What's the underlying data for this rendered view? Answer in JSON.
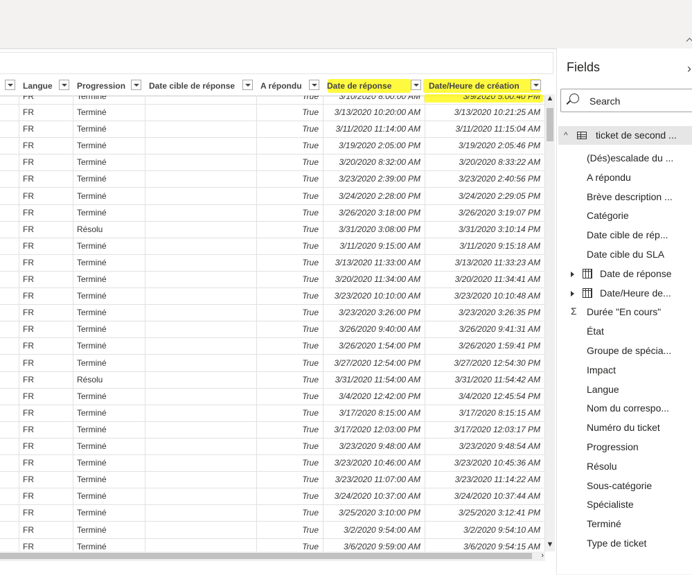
{
  "table": {
    "columns": [
      {
        "key": "blank",
        "label": ""
      },
      {
        "key": "langue",
        "label": "Langue"
      },
      {
        "key": "progression",
        "label": "Progression"
      },
      {
        "key": "date_cible",
        "label": "Date cible de réponse"
      },
      {
        "key": "a_repondu",
        "label": "A répondu"
      },
      {
        "key": "date_reponse",
        "label": "Date de réponse"
      },
      {
        "key": "date_creation",
        "label": "Date/Heure de création"
      }
    ],
    "partial_row": {
      "langue": "FR",
      "progression": "Terminé",
      "a_repondu": "True",
      "date_reponse": "3/10/2020 8:00:00 AM",
      "date_creation": "3/9/2020 5:00:40 PM"
    },
    "rows": [
      {
        "langue": "FR",
        "progression": "Terminé",
        "date_cible": "",
        "a_repondu": "True",
        "date_reponse": "3/13/2020 10:20:00 AM",
        "date_creation": "3/13/2020 10:21:25 AM"
      },
      {
        "langue": "FR",
        "progression": "Terminé",
        "date_cible": "",
        "a_repondu": "True",
        "date_reponse": "3/11/2020 11:14:00 AM",
        "date_creation": "3/11/2020 11:15:04 AM"
      },
      {
        "langue": "FR",
        "progression": "Terminé",
        "date_cible": "",
        "a_repondu": "True",
        "date_reponse": "3/19/2020 2:05:00 PM",
        "date_creation": "3/19/2020 2:05:46 PM"
      },
      {
        "langue": "FR",
        "progression": "Terminé",
        "date_cible": "",
        "a_repondu": "True",
        "date_reponse": "3/20/2020 8:32:00 AM",
        "date_creation": "3/20/2020 8:33:22 AM"
      },
      {
        "langue": "FR",
        "progression": "Terminé",
        "date_cible": "",
        "a_repondu": "True",
        "date_reponse": "3/23/2020 2:39:00 PM",
        "date_creation": "3/23/2020 2:40:56 PM"
      },
      {
        "langue": "FR",
        "progression": "Terminé",
        "date_cible": "",
        "a_repondu": "True",
        "date_reponse": "3/24/2020 2:28:00 PM",
        "date_creation": "3/24/2020 2:29:05 PM"
      },
      {
        "langue": "FR",
        "progression": "Terminé",
        "date_cible": "",
        "a_repondu": "True",
        "date_reponse": "3/26/2020 3:18:00 PM",
        "date_creation": "3/26/2020 3:19:07 PM"
      },
      {
        "langue": "FR",
        "progression": "Résolu",
        "date_cible": "",
        "a_repondu": "True",
        "date_reponse": "3/31/2020 3:08:00 PM",
        "date_creation": "3/31/2020 3:10:14 PM"
      },
      {
        "langue": "FR",
        "progression": "Terminé",
        "date_cible": "",
        "a_repondu": "True",
        "date_reponse": "3/11/2020 9:15:00 AM",
        "date_creation": "3/11/2020 9:15:18 AM"
      },
      {
        "langue": "FR",
        "progression": "Terminé",
        "date_cible": "",
        "a_repondu": "True",
        "date_reponse": "3/13/2020 11:33:00 AM",
        "date_creation": "3/13/2020 11:33:23 AM"
      },
      {
        "langue": "FR",
        "progression": "Terminé",
        "date_cible": "",
        "a_repondu": "True",
        "date_reponse": "3/20/2020 11:34:00 AM",
        "date_creation": "3/20/2020 11:34:41 AM"
      },
      {
        "langue": "FR",
        "progression": "Terminé",
        "date_cible": "",
        "a_repondu": "True",
        "date_reponse": "3/23/2020 10:10:00 AM",
        "date_creation": "3/23/2020 10:10:48 AM"
      },
      {
        "langue": "FR",
        "progression": "Terminé",
        "date_cible": "",
        "a_repondu": "True",
        "date_reponse": "3/23/2020 3:26:00 PM",
        "date_creation": "3/23/2020 3:26:35 PM"
      },
      {
        "langue": "FR",
        "progression": "Terminé",
        "date_cible": "",
        "a_repondu": "True",
        "date_reponse": "3/26/2020 9:40:00 AM",
        "date_creation": "3/26/2020 9:41:31 AM"
      },
      {
        "langue": "FR",
        "progression": "Terminé",
        "date_cible": "",
        "a_repondu": "True",
        "date_reponse": "3/26/2020 1:54:00 PM",
        "date_creation": "3/26/2020 1:59:41 PM"
      },
      {
        "langue": "FR",
        "progression": "Terminé",
        "date_cible": "",
        "a_repondu": "True",
        "date_reponse": "3/27/2020 12:54:00 PM",
        "date_creation": "3/27/2020 12:54:30 PM"
      },
      {
        "langue": "FR",
        "progression": "Résolu",
        "date_cible": "",
        "a_repondu": "True",
        "date_reponse": "3/31/2020 11:54:00 AM",
        "date_creation": "3/31/2020 11:54:42 AM"
      },
      {
        "langue": "FR",
        "progression": "Terminé",
        "date_cible": "",
        "a_repondu": "True",
        "date_reponse": "3/4/2020 12:42:00 PM",
        "date_creation": "3/4/2020 12:45:54 PM"
      },
      {
        "langue": "FR",
        "progression": "Terminé",
        "date_cible": "",
        "a_repondu": "True",
        "date_reponse": "3/17/2020 8:15:00 AM",
        "date_creation": "3/17/2020 8:15:15 AM"
      },
      {
        "langue": "FR",
        "progression": "Terminé",
        "date_cible": "",
        "a_repondu": "True",
        "date_reponse": "3/17/2020 12:03:00 PM",
        "date_creation": "3/17/2020 12:03:17 PM"
      },
      {
        "langue": "FR",
        "progression": "Terminé",
        "date_cible": "",
        "a_repondu": "True",
        "date_reponse": "3/23/2020 9:48:00 AM",
        "date_creation": "3/23/2020 9:48:54 AM"
      },
      {
        "langue": "FR",
        "progression": "Terminé",
        "date_cible": "",
        "a_repondu": "True",
        "date_reponse": "3/23/2020 10:46:00 AM",
        "date_creation": "3/23/2020 10:45:36 AM"
      },
      {
        "langue": "FR",
        "progression": "Terminé",
        "date_cible": "",
        "a_repondu": "True",
        "date_reponse": "3/23/2020 11:07:00 AM",
        "date_creation": "3/23/2020 11:14:22 AM"
      },
      {
        "langue": "FR",
        "progression": "Terminé",
        "date_cible": "",
        "a_repondu": "True",
        "date_reponse": "3/24/2020 10:37:00 AM",
        "date_creation": "3/24/2020 10:37:44 AM"
      },
      {
        "langue": "FR",
        "progression": "Terminé",
        "date_cible": "",
        "a_repondu": "True",
        "date_reponse": "3/25/2020 3:10:00 PM",
        "date_creation": "3/25/2020 3:12:41 PM"
      },
      {
        "langue": "FR",
        "progression": "Terminé",
        "date_cible": "",
        "a_repondu": "True",
        "date_reponse": "3/2/2020 9:54:00 AM",
        "date_creation": "3/2/2020 9:54:10 AM"
      },
      {
        "langue": "FR",
        "progression": "Terminé",
        "date_cible": "",
        "a_repondu": "True",
        "date_reponse": "3/6/2020 9:59:00 AM",
        "date_creation": "3/6/2020 9:54:15 AM"
      }
    ],
    "highlight_color": "#fff700"
  },
  "fields_pane": {
    "title": "Fields",
    "collapse_icon": "chevron-right-icon",
    "search_placeholder": "Search",
    "table_name": "ticket de second ...",
    "fields": [
      {
        "label": "(Dés)escalade du ...",
        "kind": "text"
      },
      {
        "label": "A répondu",
        "kind": "text"
      },
      {
        "label": "Brève description ...",
        "kind": "text"
      },
      {
        "label": "Catégorie",
        "kind": "text"
      },
      {
        "label": "Date cible de rép...",
        "kind": "text"
      },
      {
        "label": "Date cible du SLA",
        "kind": "text"
      },
      {
        "label": "Date de réponse",
        "kind": "date"
      },
      {
        "label": "Date/Heure de...",
        "kind": "date"
      },
      {
        "label": "Durée \"En cours\"",
        "kind": "sum"
      },
      {
        "label": "État",
        "kind": "text"
      },
      {
        "label": "Groupe de spécia...",
        "kind": "text"
      },
      {
        "label": "Impact",
        "kind": "text"
      },
      {
        "label": "Langue",
        "kind": "text"
      },
      {
        "label": "Nom du correspo...",
        "kind": "text"
      },
      {
        "label": "Numéro du ticket",
        "kind": "text"
      },
      {
        "label": "Progression",
        "kind": "text"
      },
      {
        "label": "Résolu",
        "kind": "text"
      },
      {
        "label": "Sous-catégorie",
        "kind": "text"
      },
      {
        "label": "Spécialiste",
        "kind": "text"
      },
      {
        "label": "Terminé",
        "kind": "text"
      },
      {
        "label": "Type de ticket",
        "kind": "text"
      }
    ]
  }
}
